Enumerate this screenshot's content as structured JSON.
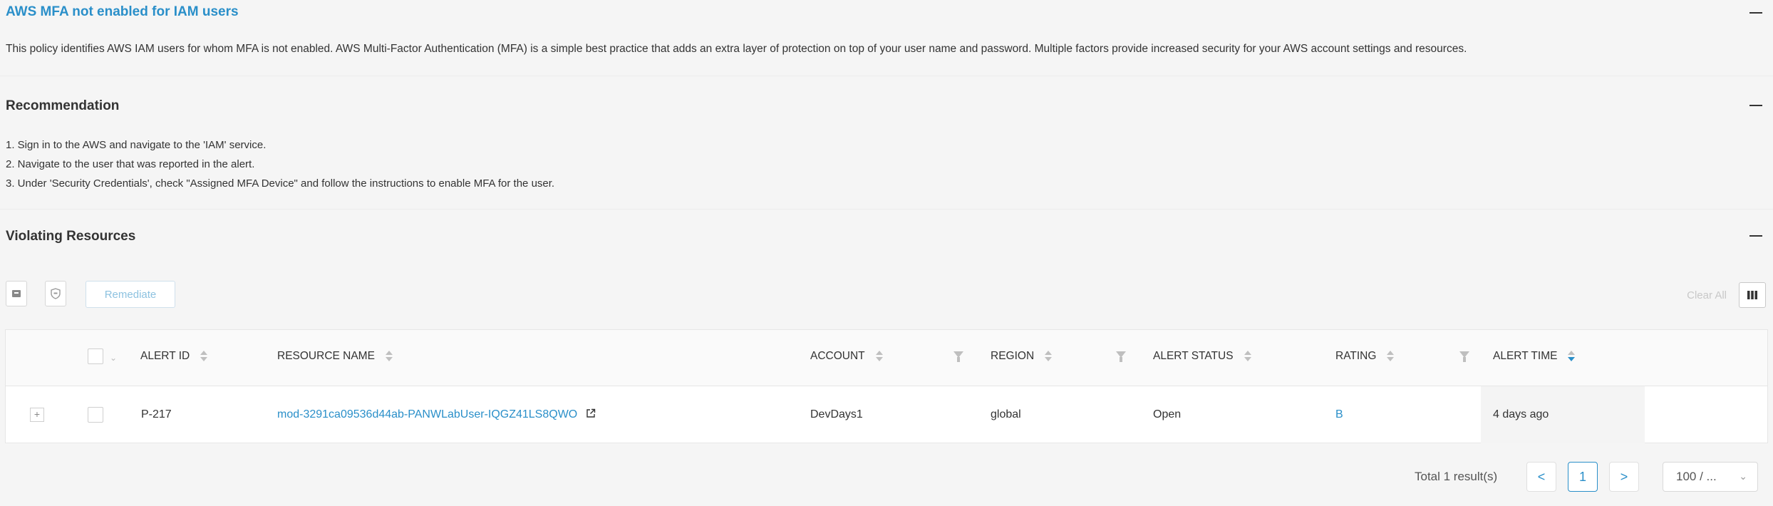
{
  "policy": {
    "title": "AWS MFA not enabled for IAM users",
    "description": "This policy identifies AWS IAM users for whom MFA is not enabled. AWS Multi-Factor Authentication (MFA) is a simple best practice that adds an extra layer of protection on top of your user name and password. Multiple factors provide increased security for your AWS account settings and resources."
  },
  "recommendation": {
    "title": "Recommendation",
    "steps": [
      "1. Sign in to the AWS and navigate to the 'IAM' service.",
      "2. Navigate to the user that was reported in the alert.",
      "3. Under 'Security Credentials', check \"Assigned MFA Device\" and follow the instructions to enable MFA for the user."
    ]
  },
  "violating": {
    "title": "Violating Resources",
    "toolbar": {
      "archive_icon": "archive-icon",
      "shield_icon": "shield-icon",
      "remediate_label": "Remediate",
      "clear_all_label": "Clear All",
      "columns_icon": "columns-icon"
    },
    "columns": {
      "alert_id": "ALERT ID",
      "resource_name": "RESOURCE NAME",
      "account": "ACCOUNT",
      "region": "REGION",
      "alert_status": "ALERT STATUS",
      "rating": "RATING",
      "alert_time": "ALERT TIME"
    },
    "rows": [
      {
        "alert_id": "P-217",
        "resource_name": "mod-3291ca09536d44ab-PANWLabUser-IQGZ41LS8QWO",
        "account": "DevDays1",
        "region": "global",
        "alert_status": "Open",
        "rating": "B",
        "alert_time": "4 days ago"
      }
    ],
    "pagination": {
      "total": "Total 1 result(s)",
      "prev": "<",
      "current_page": "1",
      "next": ">",
      "page_size": "100 / ..."
    }
  },
  "colors": {
    "accent": "#2a8fc9",
    "background": "#f4f4f4"
  }
}
